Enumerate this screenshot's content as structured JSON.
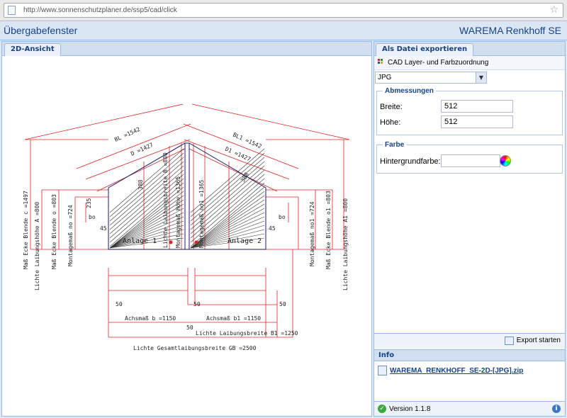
{
  "browser": {
    "url": "http://www.sonnenschutzplaner.de/ssp5/cad/click"
  },
  "window": {
    "title": "Übergabefenster",
    "brand": "WAREMA Renkhoff SE"
  },
  "left_panel": {
    "tab": "2D-Ansicht",
    "drawing": {
      "anlage_1": "Anlage 1",
      "anlage_2": "Anlage 2",
      "dim_bl": "BL =1542",
      "dim_d": "D =1427",
      "dim_bl1": "BL1 =1542",
      "dim_d1": "D1 =1427",
      "dim_gb": "Lichte Gesamtlaibungsbreite GB =2500",
      "dim_b1": "Lichte Laibungsbreite B1 =1250",
      "dim_achsmass_b": "Achsmaß b =1150",
      "dim_achsmass_b1": "Achsmaß b1 =1150",
      "dim_50_left": "50",
      "dim_50_mid": "50",
      "dim_50_center": "50",
      "dim_50_right": "50",
      "dim_a": "Lichte Laibungshöhe A =800",
      "dim_a1": "Lichte Laibungshöhe A1 =800",
      "dim_c": "Maß Ecke Blende c =1497",
      "dim_o": "Maß Ecke Blende o =803",
      "dim_o1": "Maß Ecke Blende o1 =803",
      "dim_no": "Montagemaß no =724",
      "dim_no1": "Montagemaß no1 =724",
      "dim_lb": "Lichte Laibungsbreite B =800",
      "dim_mh": "Montagemaß Höhe =1365",
      "dim_mh1": "Montagemaß no1 =1365",
      "dim_45_left": "45",
      "dim_45_right": "45",
      "dim_bo": "bo",
      "dim_bo1": "bo",
      "dim_235": "235",
      "dim_diag_l": "388",
      "dim_diag_r": "388"
    }
  },
  "right_panel": {
    "tab": "Als Datei exportieren",
    "layer_label": "CAD Layer- und Farbzuordnung",
    "format_value": "JPG",
    "dimensions": {
      "legend": "Abmessungen",
      "width_label": "Breite:",
      "width_value": "512",
      "height_label": "Höhe:",
      "height_value": "512"
    },
    "color": {
      "legend": "Farbe",
      "bg_label": "Hintergrundfarbe:",
      "bg_value": ""
    },
    "export_label": "Export starten",
    "info_title": "Info",
    "file_link": "WAREMA_RENKHOFF_SE-2D-[JPG].zip",
    "version": "Version 1.1.8"
  },
  "colors": {
    "header_blue": "#15428b",
    "border_blue": "#99bbe8",
    "dimension_red": "#e02020",
    "drawing_navy": "#1a1a6e"
  }
}
